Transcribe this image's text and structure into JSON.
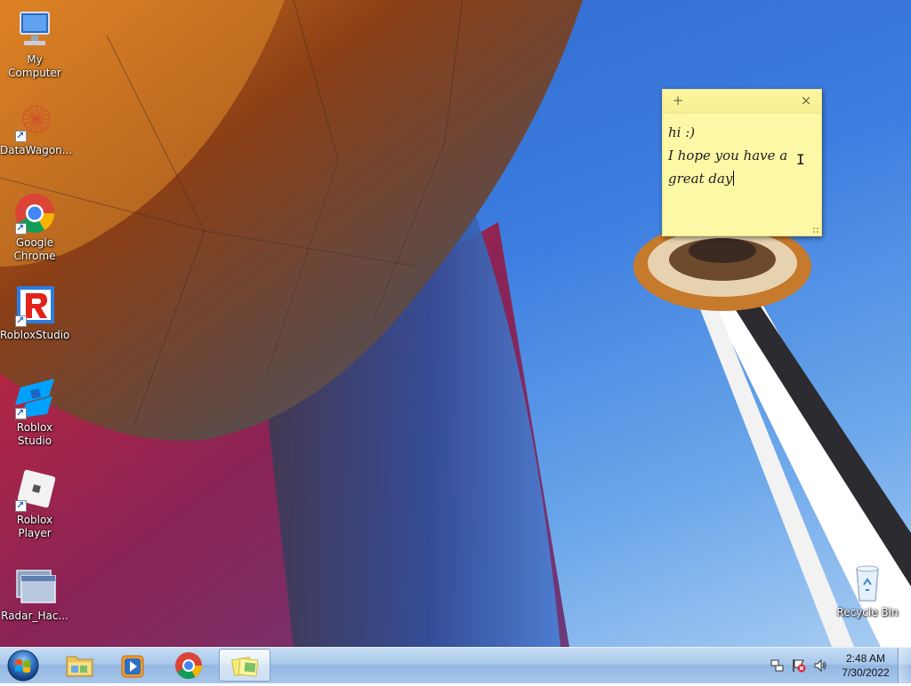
{
  "desktop_icons": [
    {
      "label": "My Computer",
      "icon": "computer-icon",
      "shortcut": false
    },
    {
      "label": "DataWagon...",
      "icon": "datawagon-icon",
      "shortcut": true
    },
    {
      "label": "Google Chrome",
      "icon": "chrome-icon",
      "shortcut": true
    },
    {
      "label": "RobloxStudio",
      "icon": "roblox-studio-old-icon",
      "shortcut": true
    },
    {
      "label": "Roblox Studio",
      "icon": "roblox-studio-icon",
      "shortcut": true
    },
    {
      "label": "Roblox Player",
      "icon": "roblox-player-icon",
      "shortcut": true
    },
    {
      "label": "Radar_Hac...",
      "icon": "window-app-icon",
      "shortcut": false
    },
    {
      "label": "Recycle Bin",
      "icon": "recycle-bin-icon",
      "shortcut": false
    }
  ],
  "sticky_note": {
    "add_glyph": "+",
    "close_glyph": "×",
    "lines": [
      "hi :)",
      "I hope you have a",
      "great day"
    ]
  },
  "taskbar": {
    "start": "windows-start-icon",
    "pinned": [
      {
        "name": "file-explorer",
        "icon": "folder-icon",
        "active": false
      },
      {
        "name": "media-player",
        "icon": "media-player-icon",
        "active": false
      },
      {
        "name": "chrome",
        "icon": "chrome-icon",
        "active": false
      },
      {
        "name": "sticky-notes",
        "icon": "sticky-notes-icon",
        "active": true
      }
    ],
    "tray": [
      "network-icon",
      "action-center-icon",
      "volume-icon"
    ],
    "time": "2:48 AM",
    "date": "7/30/2022"
  },
  "colors": {
    "sticky_bg": "#fdf8a6",
    "sky": "#3c7ee0",
    "taskbar": "#a9c8eb"
  }
}
